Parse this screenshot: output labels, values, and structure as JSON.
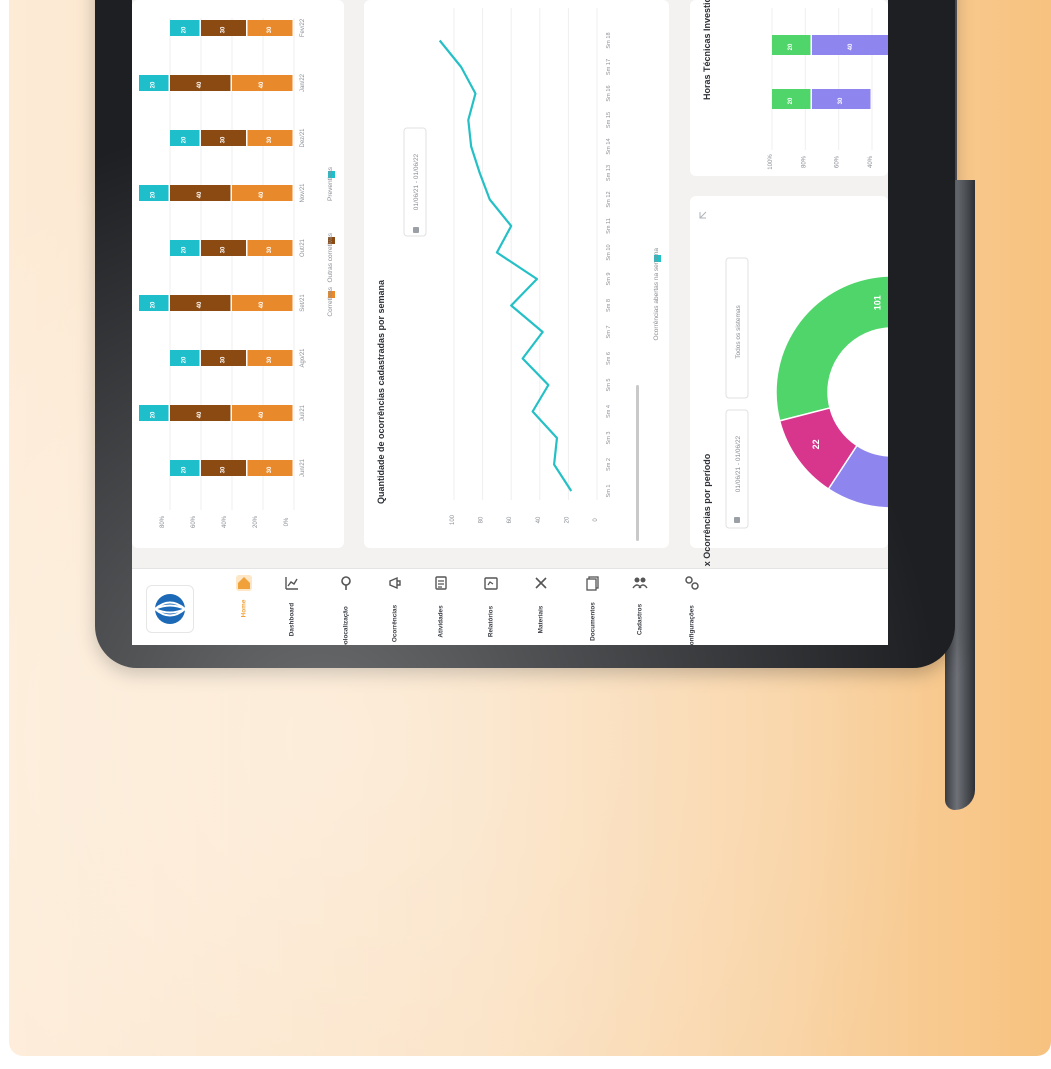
{
  "nav": {
    "items": [
      {
        "label": "Home",
        "icon": "home-icon",
        "active": true
      },
      {
        "label": "Dashboard",
        "icon": "chart-icon"
      },
      {
        "label": "Geolocalização",
        "icon": "location-pin-icon"
      },
      {
        "label": "Ocorrências",
        "icon": "megaphone-icon"
      },
      {
        "label": "Atividades",
        "icon": "clipboard-icon"
      },
      {
        "label": "Relatórios",
        "icon": "report-icon"
      },
      {
        "label": "Materiais",
        "icon": "tools-icon"
      },
      {
        "label": "Documentos",
        "icon": "documents-icon"
      },
      {
        "label": "Cadastros",
        "icon": "people-icon"
      },
      {
        "label": "Configurações",
        "icon": "gears-icon"
      }
    ],
    "accent": "#f0a13a"
  },
  "monthly_chart": {
    "legend": [
      "Corretivas",
      "Outras corretivas",
      "Preventivas"
    ],
    "colors": [
      "#e8892b",
      "#8b4a12",
      "#1fbecb"
    ],
    "y_ticks": [
      "0%",
      "20%",
      "40%",
      "60%",
      "80%"
    ]
  },
  "weekly_card": {
    "title": "Quantidade de ocorrências cadastradas por semana",
    "date_range": "01/06/21 - 01/06/22",
    "legend": "Ocorrências abertas na semana",
    "color": "#24c0c6",
    "y_ticks": [
      "0",
      "20",
      "40",
      "60",
      "80",
      "100"
    ]
  },
  "donut_card": {
    "title": "Atividades x Ocorrências por período",
    "date_range": "01/06/21 - 01/06/22",
    "filter": "Todos os sistemas",
    "expand_icon": "expand-icon"
  },
  "hours_card": {
    "title": "Horas Técnicas Investidas - Ativi",
    "y_ticks": [
      "100%",
      "80%",
      "60%",
      "40%"
    ]
  },
  "chart_data": [
    {
      "type": "bar",
      "stacked": true,
      "categories": [
        "Jun/21",
        "Jul/21",
        "Ago/21",
        "Set/21",
        "Out/21",
        "Nov/21",
        "Dez/21",
        "Jan/22",
        "Fev/22"
      ],
      "series": [
        {
          "name": "Corretivas",
          "values": [
            30,
            40,
            30,
            40,
            30,
            40,
            30,
            40,
            30
          ]
        },
        {
          "name": "Outras corretivas",
          "values": [
            30,
            40,
            30,
            40,
            30,
            40,
            30,
            40,
            30
          ]
        },
        {
          "name": "Preventivas",
          "values": [
            20,
            20,
            20,
            20,
            20,
            20,
            20,
            20,
            20
          ]
        }
      ],
      "ylim": [
        0,
        100
      ],
      "legend": "bottom"
    },
    {
      "type": "line",
      "title": "Quantidade de ocorrências cadastradas por semana",
      "x": [
        "Sm 1",
        "Sm 2",
        "Sm 3",
        "Sm 4",
        "Sm 5",
        "Sm 6",
        "Sm 7",
        "Sm 8",
        "Sm 9",
        "Sm 10",
        "Sm 11",
        "Sm 12",
        "Sm 13",
        "Sm 14",
        "Sm 15",
        "Sm 16",
        "Sm 17",
        "Sm 18"
      ],
      "series": [
        {
          "name": "Ocorrências abertas na semana",
          "values": [
            18,
            30,
            28,
            45,
            34,
            52,
            38,
            60,
            42,
            70,
            60,
            75,
            82,
            88,
            90,
            85,
            95,
            110
          ]
        }
      ],
      "ylim": [
        0,
        100
      ],
      "legend": "bottom"
    },
    {
      "type": "pie",
      "title": "Atividades x Ocorrências por período",
      "labels": [
        "",
        "",
        ""
      ],
      "values": [
        101,
        64,
        22
      ],
      "colors": [
        "#4fd56a",
        "#8e86ee",
        "#d8358d"
      ]
    },
    {
      "type": "bar",
      "stacked": true,
      "title": "Horas Técnicas Investidas - Ativi",
      "series": [
        {
          "values": [
            20,
            20
          ]
        },
        {
          "values": [
            30,
            40
          ]
        },
        {
          "values": [
            0,
            10
          ]
        }
      ],
      "ylim": [
        40,
        100
      ],
      "colors": [
        "#4fd56a",
        "#8e86ee",
        "#d8358d"
      ]
    }
  ]
}
